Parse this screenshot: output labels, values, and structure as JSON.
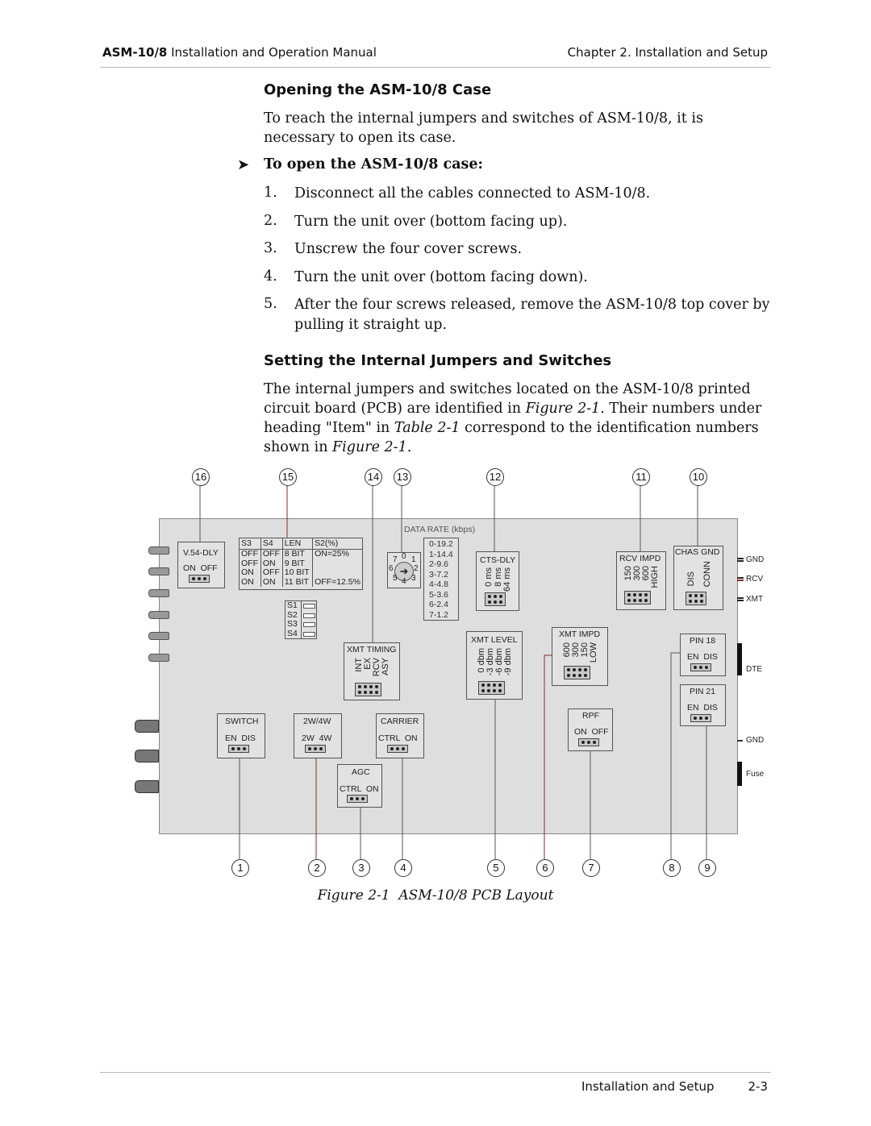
{
  "header": {
    "left_bold": "ASM-10/8",
    "left_rest": " Installation and Operation Manual",
    "right": "Chapter 2.  Installation and Setup"
  },
  "section1": {
    "title": "Opening the ASM-10/8 Case",
    "intro": "To reach the internal jumpers and switches of ASM-10/8, it is necessary to open its case.",
    "procedure_title": "To open the ASM-10/8 case:",
    "steps": [
      {
        "n": "1.",
        "text": "Disconnect all the cables connected to ASM-10/8."
      },
      {
        "n": "2.",
        "text": "Turn the unit over (bottom facing up)."
      },
      {
        "n": "3.",
        "text": "Unscrew the four cover screws."
      },
      {
        "n": "4.",
        "text": "Turn the unit over (bottom facing down)."
      },
      {
        "n": "5.",
        "text": "After the four screws released, remove the ASM-10/8 top cover by pulling it straight up."
      }
    ]
  },
  "section2": {
    "title": "Setting the Internal Jumpers and Switches",
    "p1": "The internal jumpers and switches located on the ASM-10/8 printed circuit board (PCB) are identified in ",
    "fig1": "Figure 2-1",
    "p2": ". Their numbers under heading \"Item\" in ",
    "tab1": "Table 2-1",
    "p3": " correspond to the identification numbers shown in ",
    "fig2": "Figure 2-1",
    "p4": "."
  },
  "figure": {
    "callouts_top": [
      "16",
      "15",
      "14",
      "13",
      "12",
      "11",
      "10"
    ],
    "callouts_bottom": [
      "1",
      "2",
      "3",
      "4",
      "5",
      "6",
      "7",
      "8",
      "9"
    ],
    "v54": {
      "title": "V.54-DLY",
      "opts": "ON  OFF"
    },
    "s_table": {
      "headers": [
        "S3",
        "S4",
        "LEN",
        "S2(%)"
      ],
      "rows": [
        [
          "OFF",
          "OFF",
          "8 BIT",
          "ON=25%"
        ],
        [
          "OFF",
          "ON",
          "9 BIT",
          ""
        ],
        [
          "ON",
          "OFF",
          "10 BIT",
          ""
        ],
        [
          "ON",
          "ON",
          "11 BIT",
          "OFF=12.5%"
        ]
      ]
    },
    "dip": [
      "S1",
      "S2",
      "S3",
      "S4"
    ],
    "rotary": [
      "0",
      "1",
      "2",
      "3",
      "4",
      "5",
      "6",
      "7"
    ],
    "data_rate": {
      "title": "DATA RATE (kbps)",
      "items": [
        "0-19.2",
        "1-14.4",
        "2-9.6",
        "3-7.2",
        "4-4.8",
        "5-3.6",
        "6-2.4",
        "7-1.2"
      ]
    },
    "cts": {
      "title": "CTS-DLY",
      "opts": [
        "0 ms",
        "8 ms",
        "64 ms"
      ]
    },
    "xmt_timing": {
      "title": "XMT TIMING",
      "opts": [
        "INT",
        "EX",
        "RCV",
        "ASY"
      ]
    },
    "xmt_level": {
      "title": "XMT LEVEL",
      "opts": [
        "0 dbm",
        "-3 dbm",
        "-6 dbm",
        "-9 dbm"
      ]
    },
    "xmt_impd": {
      "title": "XMT IMPD",
      "opts": [
        "600",
        "300",
        "150",
        "LOW"
      ]
    },
    "rcv_impd": {
      "title": "RCV IMPD",
      "opts": [
        "150",
        "300",
        "600",
        "HIGH"
      ]
    },
    "chas_gnd": {
      "title": "CHAS GND",
      "opts": [
        "DIS",
        "CONN"
      ]
    },
    "pin18": {
      "title": "PIN 18",
      "opts": "EN  DIS"
    },
    "pin21": {
      "title": "PIN 21",
      "opts": "EN  DIS"
    },
    "rpf": {
      "title": "RPF",
      "opts": "ON  OFF"
    },
    "switch": {
      "title": "SWITCH",
      "opts": "EN  DIS"
    },
    "w24": {
      "title": "2W/4W",
      "opts": "2W  4W"
    },
    "carrier": {
      "title": "CARRIER",
      "opts": "CTRL  ON"
    },
    "agc": {
      "title": "AGC",
      "opts": "CTRL  ON"
    },
    "right_labels": {
      "gnd1": "GND",
      "rcv": "RCV",
      "xmt": "XMT",
      "dte": "DTE",
      "gnd2": "GND",
      "fuse": "Fuse"
    },
    "caption_num": "Figure 2-1",
    "caption_text": "ASM-10/8 PCB Layout"
  },
  "footer": {
    "section": "Installation and Setup",
    "page": "2-3"
  }
}
